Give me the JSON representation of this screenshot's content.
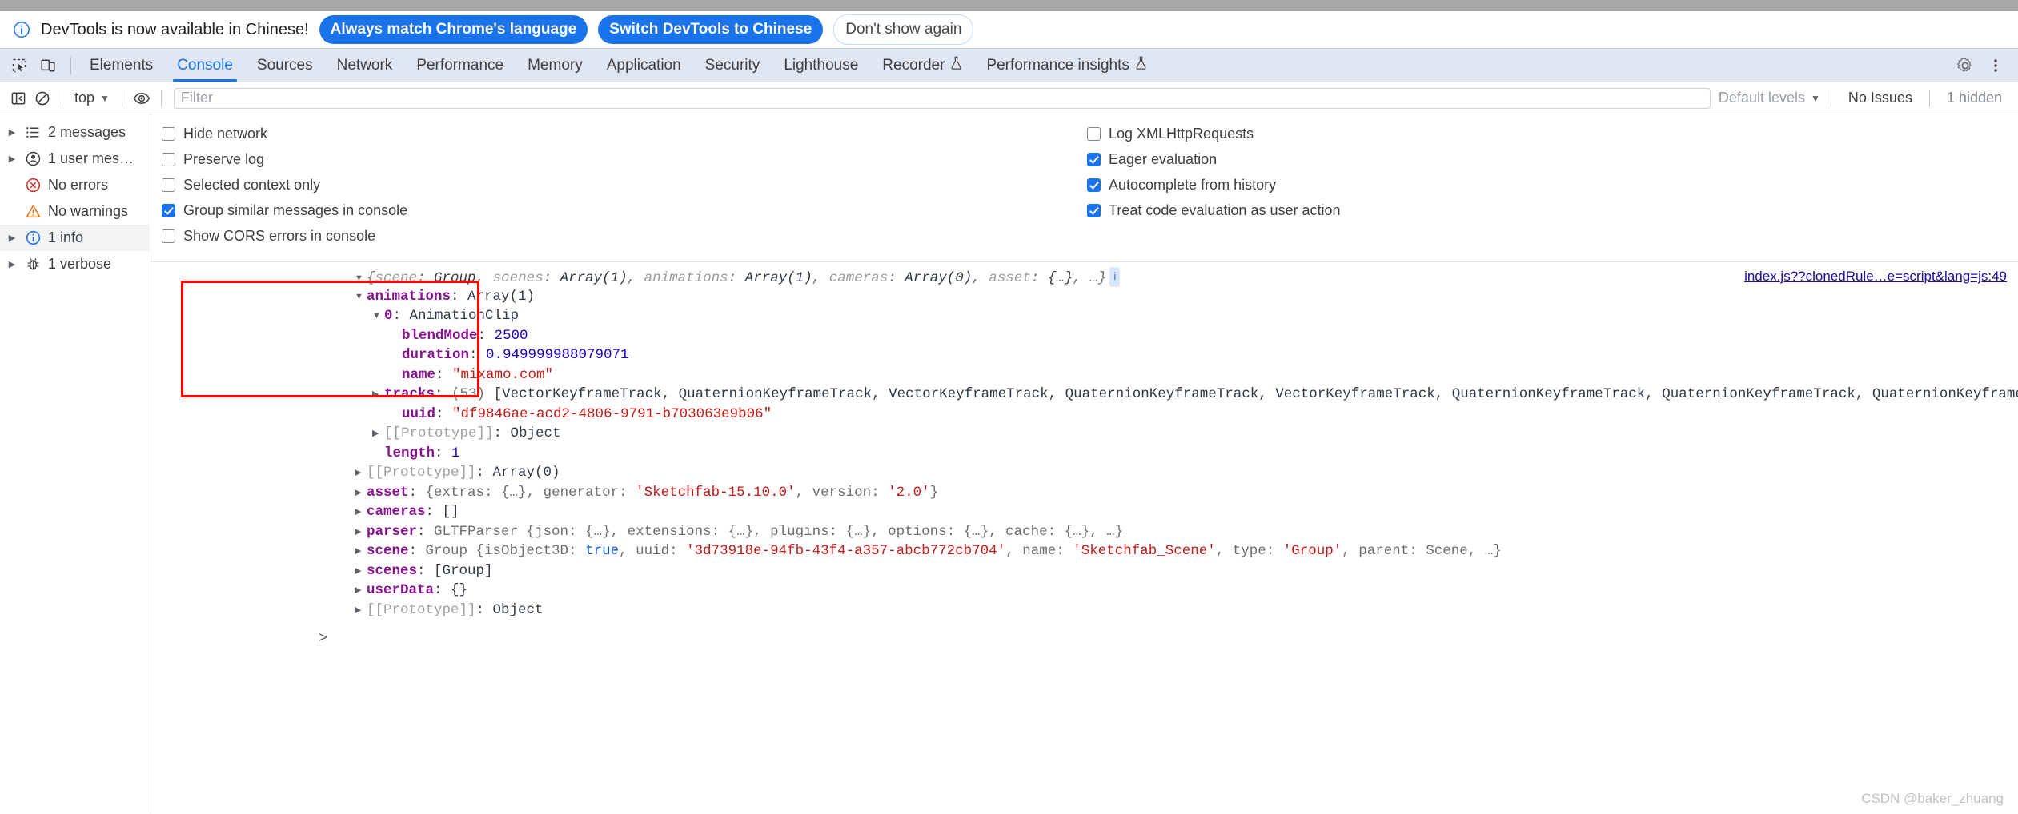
{
  "banner": {
    "icon": "info-circle-icon",
    "message": "DevTools is now available in Chinese!",
    "primary_button_1": "Always match Chrome's language",
    "primary_button_2": "Switch DevTools to Chinese",
    "ghost_button": "Don't show again"
  },
  "tabbar": {
    "inspect_icon": "inspect-cursor-icon",
    "device_icon": "device-toolbar-icon",
    "tabs": [
      {
        "label": "Elements",
        "active": false,
        "experiment": false
      },
      {
        "label": "Console",
        "active": true,
        "experiment": false
      },
      {
        "label": "Sources",
        "active": false,
        "experiment": false
      },
      {
        "label": "Network",
        "active": false,
        "experiment": false
      },
      {
        "label": "Performance",
        "active": false,
        "experiment": false
      },
      {
        "label": "Memory",
        "active": false,
        "experiment": false
      },
      {
        "label": "Application",
        "active": false,
        "experiment": false
      },
      {
        "label": "Security",
        "active": false,
        "experiment": false
      },
      {
        "label": "Lighthouse",
        "active": false,
        "experiment": false
      },
      {
        "label": "Recorder",
        "active": false,
        "experiment": true
      },
      {
        "label": "Performance insights",
        "active": false,
        "experiment": true
      }
    ],
    "settings_icon": "gear-icon",
    "more_icon": "kebab-menu-icon"
  },
  "console_toolbar": {
    "sidebar_toggle_icon": "show-console-sidebar-icon",
    "clear_icon": "clear-console-icon",
    "context": "top",
    "eye_icon": "live-expressions-eye-icon",
    "filter_placeholder": "Filter",
    "filter_value": "",
    "levels": "Default levels",
    "issues": "No Issues",
    "hidden": "1 hidden"
  },
  "sidebar": {
    "items": [
      {
        "label": "2 messages",
        "icon": "list-icon",
        "expandable": true,
        "selected": false
      },
      {
        "label": "1 user mes…",
        "icon": "user-icon",
        "expandable": true,
        "selected": false
      },
      {
        "label": "No errors",
        "icon": "error-icon",
        "expandable": false,
        "selected": false
      },
      {
        "label": "No warnings",
        "icon": "warning-icon",
        "expandable": false,
        "selected": false
      },
      {
        "label": "1 info",
        "icon": "info-icon",
        "expandable": true,
        "selected": true
      },
      {
        "label": "1 verbose",
        "icon": "bug-icon",
        "expandable": true,
        "selected": false
      }
    ]
  },
  "settings": {
    "left": [
      {
        "label": "Hide network",
        "checked": false
      },
      {
        "label": "Preserve log",
        "checked": false
      },
      {
        "label": "Selected context only",
        "checked": false
      },
      {
        "label": "Group similar messages in console",
        "checked": true
      },
      {
        "label": "Show CORS errors in console",
        "checked": false
      }
    ],
    "right": [
      {
        "label": "Log XMLHttpRequests",
        "checked": false
      },
      {
        "label": "Eager evaluation",
        "checked": true
      },
      {
        "label": "Autocomplete from history",
        "checked": true
      },
      {
        "label": "Treat code evaluation as user action",
        "checked": true
      }
    ]
  },
  "console_message": {
    "source_link": "index.js??clonedRule…e=script&lang=js:49",
    "header": {
      "open_brace": "{",
      "parts": [
        {
          "key": "scene",
          "value": "Group"
        },
        {
          "key": "scenes",
          "value": "Array(1)"
        },
        {
          "key": "animations",
          "value": "Array(1)"
        },
        {
          "key": "cameras",
          "value": "Array(0)"
        },
        {
          "key": "asset",
          "value": "{…}"
        }
      ],
      "ellipsis": "…}",
      "badge": "i"
    },
    "tree": {
      "animations_key": "animations",
      "animations_val": "Array(1)",
      "clip_index": "0",
      "clip_type": "AnimationClip",
      "blendMode_key": "blendMode",
      "blendMode_val": "2500",
      "duration_key": "duration",
      "duration_val": "0.949999988079071",
      "name_key": "name",
      "name_val": "\"mixamo.com\"",
      "tracks_key": "tracks",
      "tracks_count": "(53)",
      "tracks_val": "[VectorKeyframeTrack, QuaternionKeyframeTrack, VectorKeyframeTrack, QuaternionKeyframeTrack, VectorKeyframeTrack, QuaternionKeyframeTrack, QuaternionKeyframeTrack, QuaternionKeyframeTrack, QuaternionKeyframeTrack, QuaternionKeyframeTrack, QuaternionKeyframeTrac",
      "uuid_key": "uuid",
      "uuid_val": "\"df9846ae-acd2-4806-9791-b703063e9b06\"",
      "proto_key": "[[Prototype]]",
      "proto_val": "Object",
      "length_key": "length",
      "length_val": "1",
      "arr_proto_key": "[[Prototype]]",
      "arr_proto_val": "Array(0)",
      "asset_key": "asset",
      "asset_val_a": "{extras: ",
      "asset_val_b": "{…}",
      "asset_val_c": ", generator: ",
      "asset_val_d": "'Sketchfab-15.10.0'",
      "asset_val_e": ", version: ",
      "asset_val_f": "'2.0'",
      "asset_val_g": "}",
      "cameras_key": "cameras",
      "cameras_val": "[]",
      "parser_key": "parser",
      "parser_val": "GLTFParser {json: {…}, extensions: {…}, plugins: {…}, options: {…}, cache: {…}, …}",
      "scene_key": "scene",
      "scene_prefix": "Group {isObject3D: ",
      "scene_true": "true",
      "scene_mid1": ", uuid: ",
      "scene_uuid": "'3d73918e-94fb-43f4-a357-abcb772cb704'",
      "scene_mid2": ", name: ",
      "scene_name": "'Sketchfab_Scene'",
      "scene_mid3": ", type: ",
      "scene_type": "'Group'",
      "scene_mid4": ", parent: Scene, …}",
      "scenes_key": "scenes",
      "scenes_val": "[Group]",
      "userData_key": "userData",
      "userData_val": "{}",
      "root_proto_key": "[[Prototype]]",
      "root_proto_val": "Object"
    },
    "prompt_caret": ">"
  },
  "watermark": "CSDN @baker_zhuang",
  "colors": {
    "accent": "#1a73e8",
    "annotation": "#ff0000",
    "tabbar_bg": "#e0e6f2",
    "key": "#881391",
    "string": "#c41a16",
    "number": "#1c00cf"
  }
}
